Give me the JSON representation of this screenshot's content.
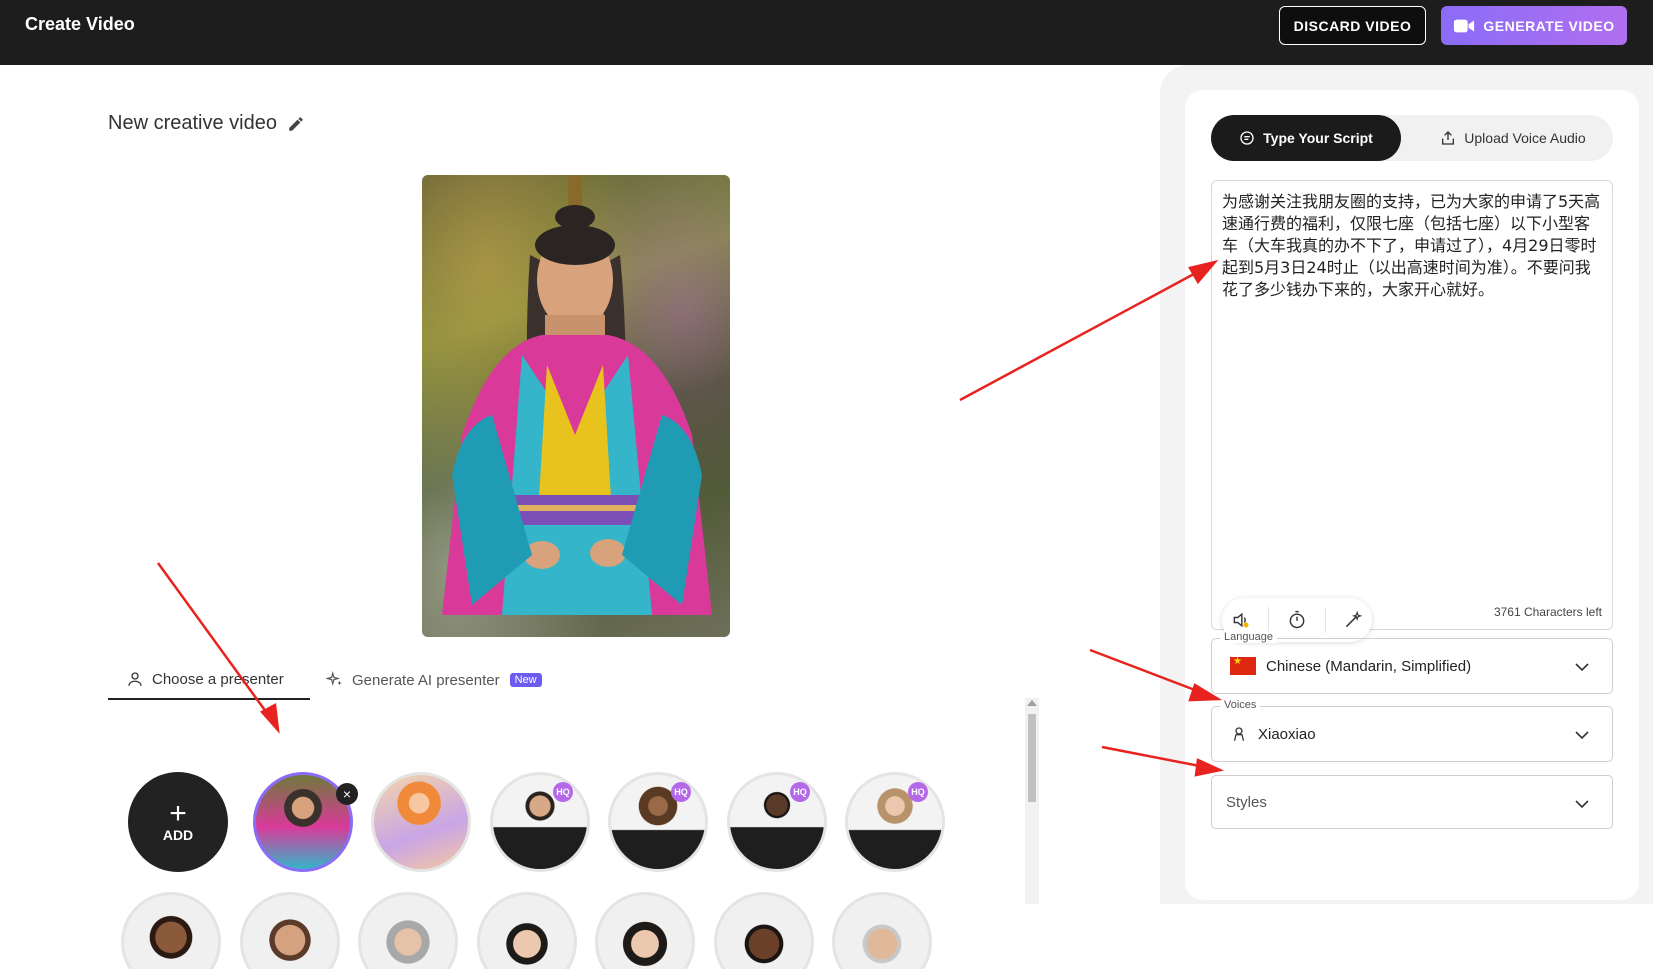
{
  "header": {
    "title": "Create Video",
    "discard_label": "DISCARD VIDEO",
    "generate_label": "GENERATE VIDEO"
  },
  "editor": {
    "video_title": "New creative video",
    "tabs": [
      {
        "label": "Choose a presenter",
        "active": true
      },
      {
        "label": "Generate AI presenter",
        "badge": "New",
        "active": false
      }
    ],
    "add_label": "ADD",
    "hq_badge": "HQ",
    "remove_symbol": "×"
  },
  "script_panel": {
    "segments": [
      {
        "label": "Type Your Script",
        "active": true
      },
      {
        "label": "Upload Voice Audio",
        "active": false
      }
    ],
    "script_text": "为感谢关注我朋友圈的支持，已为大家的申请了5天高速通行费的福利，仅限七座（包括七座）以下小型客车（大车我真的办不下了，申请过了），4月29日零时起到5月3日24时止（以出高速时间为准）。不要问我花了多少钱办下来的，大家开心就好。",
    "characters_left": "3761 Characters left",
    "language": {
      "label": "Language",
      "value": "Chinese (Mandarin, Simplified)"
    },
    "voices": {
      "label": "Voices",
      "value": "Xiaoxiao"
    },
    "styles": {
      "placeholder": "Styles"
    }
  },
  "colors": {
    "accent": "#8b6cf7",
    "hq_badge": "#b46ae8",
    "annotation_arrow": "#e8231f"
  }
}
